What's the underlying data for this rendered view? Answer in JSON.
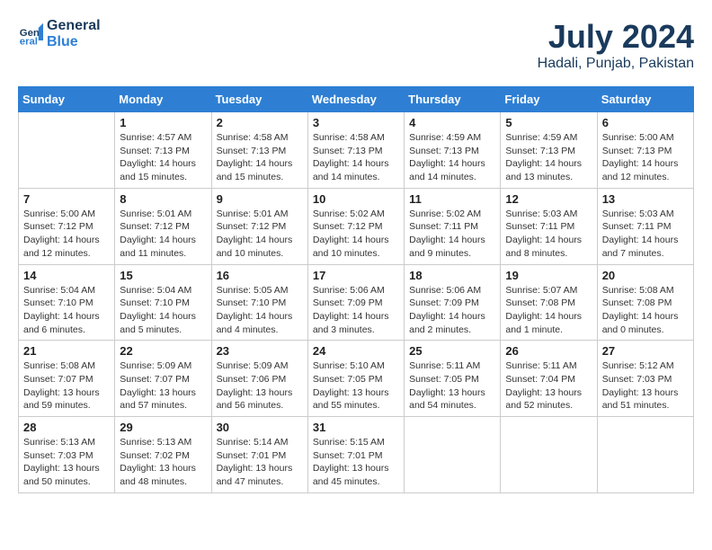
{
  "header": {
    "logo_general": "General",
    "logo_blue": "Blue",
    "month": "July 2024",
    "location": "Hadali, Punjab, Pakistan"
  },
  "weekdays": [
    "Sunday",
    "Monday",
    "Tuesday",
    "Wednesday",
    "Thursday",
    "Friday",
    "Saturday"
  ],
  "weeks": [
    [
      {
        "day": "",
        "sunrise": "",
        "sunset": "",
        "daylight": ""
      },
      {
        "day": "1",
        "sunrise": "Sunrise: 4:57 AM",
        "sunset": "Sunset: 7:13 PM",
        "daylight": "Daylight: 14 hours and 15 minutes."
      },
      {
        "day": "2",
        "sunrise": "Sunrise: 4:58 AM",
        "sunset": "Sunset: 7:13 PM",
        "daylight": "Daylight: 14 hours and 15 minutes."
      },
      {
        "day": "3",
        "sunrise": "Sunrise: 4:58 AM",
        "sunset": "Sunset: 7:13 PM",
        "daylight": "Daylight: 14 hours and 14 minutes."
      },
      {
        "day": "4",
        "sunrise": "Sunrise: 4:59 AM",
        "sunset": "Sunset: 7:13 PM",
        "daylight": "Daylight: 14 hours and 14 minutes."
      },
      {
        "day": "5",
        "sunrise": "Sunrise: 4:59 AM",
        "sunset": "Sunset: 7:13 PM",
        "daylight": "Daylight: 14 hours and 13 minutes."
      },
      {
        "day": "6",
        "sunrise": "Sunrise: 5:00 AM",
        "sunset": "Sunset: 7:13 PM",
        "daylight": "Daylight: 14 hours and 12 minutes."
      }
    ],
    [
      {
        "day": "7",
        "sunrise": "Sunrise: 5:00 AM",
        "sunset": "Sunset: 7:12 PM",
        "daylight": "Daylight: 14 hours and 12 minutes."
      },
      {
        "day": "8",
        "sunrise": "Sunrise: 5:01 AM",
        "sunset": "Sunset: 7:12 PM",
        "daylight": "Daylight: 14 hours and 11 minutes."
      },
      {
        "day": "9",
        "sunrise": "Sunrise: 5:01 AM",
        "sunset": "Sunset: 7:12 PM",
        "daylight": "Daylight: 14 hours and 10 minutes."
      },
      {
        "day": "10",
        "sunrise": "Sunrise: 5:02 AM",
        "sunset": "Sunset: 7:12 PM",
        "daylight": "Daylight: 14 hours and 10 minutes."
      },
      {
        "day": "11",
        "sunrise": "Sunrise: 5:02 AM",
        "sunset": "Sunset: 7:11 PM",
        "daylight": "Daylight: 14 hours and 9 minutes."
      },
      {
        "day": "12",
        "sunrise": "Sunrise: 5:03 AM",
        "sunset": "Sunset: 7:11 PM",
        "daylight": "Daylight: 14 hours and 8 minutes."
      },
      {
        "day": "13",
        "sunrise": "Sunrise: 5:03 AM",
        "sunset": "Sunset: 7:11 PM",
        "daylight": "Daylight: 14 hours and 7 minutes."
      }
    ],
    [
      {
        "day": "14",
        "sunrise": "Sunrise: 5:04 AM",
        "sunset": "Sunset: 7:10 PM",
        "daylight": "Daylight: 14 hours and 6 minutes."
      },
      {
        "day": "15",
        "sunrise": "Sunrise: 5:04 AM",
        "sunset": "Sunset: 7:10 PM",
        "daylight": "Daylight: 14 hours and 5 minutes."
      },
      {
        "day": "16",
        "sunrise": "Sunrise: 5:05 AM",
        "sunset": "Sunset: 7:10 PM",
        "daylight": "Daylight: 14 hours and 4 minutes."
      },
      {
        "day": "17",
        "sunrise": "Sunrise: 5:06 AM",
        "sunset": "Sunset: 7:09 PM",
        "daylight": "Daylight: 14 hours and 3 minutes."
      },
      {
        "day": "18",
        "sunrise": "Sunrise: 5:06 AM",
        "sunset": "Sunset: 7:09 PM",
        "daylight": "Daylight: 14 hours and 2 minutes."
      },
      {
        "day": "19",
        "sunrise": "Sunrise: 5:07 AM",
        "sunset": "Sunset: 7:08 PM",
        "daylight": "Daylight: 14 hours and 1 minute."
      },
      {
        "day": "20",
        "sunrise": "Sunrise: 5:08 AM",
        "sunset": "Sunset: 7:08 PM",
        "daylight": "Daylight: 14 hours and 0 minutes."
      }
    ],
    [
      {
        "day": "21",
        "sunrise": "Sunrise: 5:08 AM",
        "sunset": "Sunset: 7:07 PM",
        "daylight": "Daylight: 13 hours and 59 minutes."
      },
      {
        "day": "22",
        "sunrise": "Sunrise: 5:09 AM",
        "sunset": "Sunset: 7:07 PM",
        "daylight": "Daylight: 13 hours and 57 minutes."
      },
      {
        "day": "23",
        "sunrise": "Sunrise: 5:09 AM",
        "sunset": "Sunset: 7:06 PM",
        "daylight": "Daylight: 13 hours and 56 minutes."
      },
      {
        "day": "24",
        "sunrise": "Sunrise: 5:10 AM",
        "sunset": "Sunset: 7:05 PM",
        "daylight": "Daylight: 13 hours and 55 minutes."
      },
      {
        "day": "25",
        "sunrise": "Sunrise: 5:11 AM",
        "sunset": "Sunset: 7:05 PM",
        "daylight": "Daylight: 13 hours and 54 minutes."
      },
      {
        "day": "26",
        "sunrise": "Sunrise: 5:11 AM",
        "sunset": "Sunset: 7:04 PM",
        "daylight": "Daylight: 13 hours and 52 minutes."
      },
      {
        "day": "27",
        "sunrise": "Sunrise: 5:12 AM",
        "sunset": "Sunset: 7:03 PM",
        "daylight": "Daylight: 13 hours and 51 minutes."
      }
    ],
    [
      {
        "day": "28",
        "sunrise": "Sunrise: 5:13 AM",
        "sunset": "Sunset: 7:03 PM",
        "daylight": "Daylight: 13 hours and 50 minutes."
      },
      {
        "day": "29",
        "sunrise": "Sunrise: 5:13 AM",
        "sunset": "Sunset: 7:02 PM",
        "daylight": "Daylight: 13 hours and 48 minutes."
      },
      {
        "day": "30",
        "sunrise": "Sunrise: 5:14 AM",
        "sunset": "Sunset: 7:01 PM",
        "daylight": "Daylight: 13 hours and 47 minutes."
      },
      {
        "day": "31",
        "sunrise": "Sunrise: 5:15 AM",
        "sunset": "Sunset: 7:01 PM",
        "daylight": "Daylight: 13 hours and 45 minutes."
      },
      {
        "day": "",
        "sunrise": "",
        "sunset": "",
        "daylight": ""
      },
      {
        "day": "",
        "sunrise": "",
        "sunset": "",
        "daylight": ""
      },
      {
        "day": "",
        "sunrise": "",
        "sunset": "",
        "daylight": ""
      }
    ]
  ]
}
